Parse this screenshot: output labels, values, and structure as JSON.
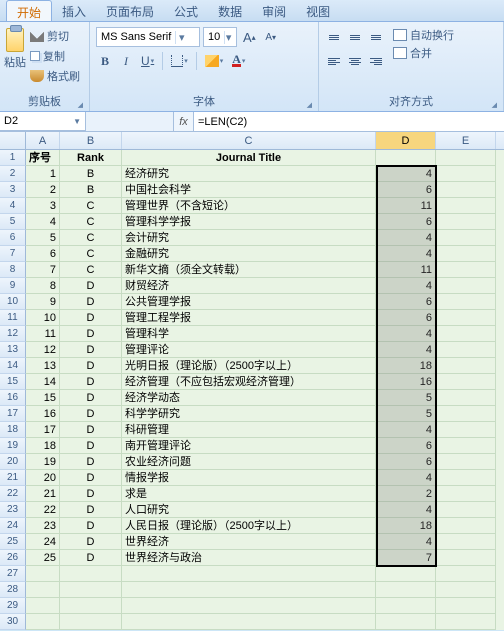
{
  "tabs": [
    "开始",
    "插入",
    "页面布局",
    "公式",
    "数据",
    "审阅",
    "视图"
  ],
  "active_tab": 0,
  "clipboard": {
    "paste": "粘贴",
    "cut": "剪切",
    "copy": "复制",
    "brush": "格式刷",
    "group": "剪贴板"
  },
  "font": {
    "name": "MS Sans Serif",
    "size": "10",
    "group": "字体",
    "bold": "B",
    "italic": "I",
    "underline": "U",
    "bigA": "A",
    "smallA": "A",
    "colorA": "A"
  },
  "align": {
    "group": "对齐方式",
    "wrap": "自动换行",
    "merge": "合并"
  },
  "namebox": "D2",
  "fx": "fx",
  "formula": "=LEN(C2)",
  "columns": [
    "A",
    "B",
    "C",
    "D",
    "E"
  ],
  "header_row": {
    "A": "序号",
    "B": "Rank",
    "C": "Journal Title",
    "D": "",
    "E": ""
  },
  "chart_data": {
    "type": "table",
    "columns": [
      "序号",
      "Rank",
      "Journal Title",
      "D"
    ],
    "rows": [
      [
        1,
        "B",
        "经济研究",
        4
      ],
      [
        2,
        "B",
        "中国社会科学",
        6
      ],
      [
        3,
        "C",
        "管理世界（不含短论）",
        11
      ],
      [
        4,
        "C",
        "管理科学学报",
        6
      ],
      [
        5,
        "C",
        "会计研究",
        4
      ],
      [
        6,
        "C",
        "金融研究",
        4
      ],
      [
        7,
        "C",
        "新华文摘（须全文转载）",
        11
      ],
      [
        8,
        "D",
        "财贸经济",
        4
      ],
      [
        9,
        "D",
        "公共管理学报",
        6
      ],
      [
        10,
        "D",
        "管理工程学报",
        6
      ],
      [
        11,
        "D",
        "管理科学",
        4
      ],
      [
        12,
        "D",
        "管理评论",
        4
      ],
      [
        13,
        "D",
        "光明日报（理论版）（2500字以上）",
        18
      ],
      [
        14,
        "D",
        "经济管理（不应包括宏观经济管理）",
        16
      ],
      [
        15,
        "D",
        "经济学动态",
        5
      ],
      [
        16,
        "D",
        "科学学研究",
        5
      ],
      [
        17,
        "D",
        "科研管理",
        4
      ],
      [
        18,
        "D",
        "南开管理评论",
        6
      ],
      [
        19,
        "D",
        "农业经济问题",
        6
      ],
      [
        20,
        "D",
        "情报学报",
        4
      ],
      [
        21,
        "D",
        "求是",
        2
      ],
      [
        22,
        "D",
        "人口研究",
        4
      ],
      [
        23,
        "D",
        "人民日报（理论版）（2500字以上）",
        18
      ],
      [
        24,
        "D",
        "世界经济",
        4
      ],
      [
        25,
        "D",
        "世界经济与政治",
        7
      ]
    ]
  }
}
